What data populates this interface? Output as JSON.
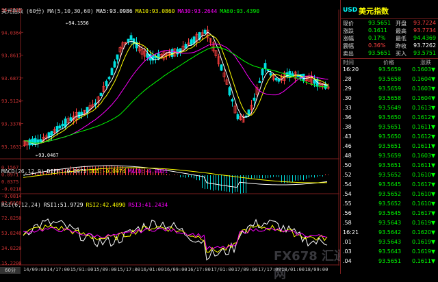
{
  "header": {
    "symbol": "美元指数",
    "period": "(60分)",
    "ma_label": "MA(5,10,30,60)",
    "ma5": "MA5:93.0986",
    "ma10": "MA10:93.0860",
    "ma30": "MA30:93.2644",
    "ma60": "MA60:93.4390"
  },
  "price_axis": [
    "94.2110",
    "94.0364",
    "93.8617",
    "93.6871",
    "93.5124",
    "93.3378",
    "93.1631"
  ],
  "annotations": {
    "high": "94.1556",
    "low": "93.0467"
  },
  "macd": {
    "label": "MACD(26,12,9)",
    "diff": "DIFF:-0.0975",
    "dea": "DEA:-0.0974",
    "macd": "MACD:-0.0001",
    "axis": [
      "0.1567",
      "0.0971",
      "0.0375",
      "-0.0218",
      "-0.0814"
    ]
  },
  "rsi": {
    "label": "RSI(6,12,24)",
    "rsi1": "RSI1:51.9729",
    "rsi2": "RSI2:42.4090",
    "rsi3": "RSI3:41.2434",
    "axis": [
      "92.8160",
      "72.8250",
      "53.8240",
      "34.8220",
      "15.2200"
    ]
  },
  "x_axis": [
    "14/09:00",
    "14/17:00",
    "15/01:00",
    "15/09:00",
    "15/17:00",
    "16/01:00",
    "16/09:00",
    "16/17:00",
    "17/01:00",
    "17/09:00",
    "17/17:00",
    "18/01:00",
    "18/09:00"
  ],
  "period_badge": "60分",
  "panel": {
    "code": "USD",
    "name": "美元指数",
    "quote_rows": [
      {
        "l1": "现价",
        "v1": "93.5651",
        "l2": "开盘",
        "v2": "93.7224"
      },
      {
        "l1": "涨跌",
        "v1": "0.1611",
        "l2": "最高",
        "v2": "93.7734"
      },
      {
        "l1": "涨幅",
        "v1": "0.17%",
        "l2": "最低",
        "v2": "94.4369"
      },
      {
        "l1": "震幅",
        "v1": "0.36%",
        "l2": "昨收",
        "v2": "93.7262"
      },
      {
        "l1": "卖出",
        "v1": "93.5651",
        "l2": "买入",
        "v2": "93.5751"
      }
    ],
    "tick_headers": {
      "time": "时间",
      "price": "价格",
      "change": "涨跌"
    },
    "ticks": [
      {
        "t": "16:20",
        "p": "93.5659",
        "c": "0.1603▼"
      },
      {
        "t": ".28",
        "p": "93.5658",
        "c": "0.1604▼"
      },
      {
        "t": ".29",
        "p": "93.5659",
        "c": "0.1603▼"
      },
      {
        "t": ".30",
        "p": "93.5658",
        "c": "0.1604▼"
      },
      {
        "t": ".33",
        "p": "93.5649",
        "c": "0.1613▼"
      },
      {
        "t": ".36",
        "p": "93.5650",
        "c": "0.1612▼"
      },
      {
        "t": ".38",
        "p": "93.5651",
        "c": "0.1611▼"
      },
      {
        "t": ".43",
        "p": "93.5650",
        "c": "0.1612▼"
      },
      {
        "t": ".46",
        "p": "93.5651",
        "c": "0.1611▼"
      },
      {
        "t": ".48",
        "p": "93.5659",
        "c": "0.1603▼"
      },
      {
        "t": ".50",
        "p": "93.5651",
        "c": "0.1611▼"
      },
      {
        "t": ".52",
        "p": "93.5652",
        "c": "0.1610▼"
      },
      {
        "t": ".54",
        "p": "93.5645",
        "c": "0.1617▼"
      },
      {
        "t": ".54",
        "p": "93.5652",
        "c": "0.1610▼"
      },
      {
        "t": ".55",
        "p": "93.5652",
        "c": "0.1610▼"
      },
      {
        "t": ".56",
        "p": "93.5645",
        "c": "0.1617▼"
      },
      {
        "t": ".58",
        "p": "93.5643",
        "c": "0.1619▼"
      },
      {
        "t": "16:21",
        "p": "93.5642",
        "c": "0.1620▼"
      },
      {
        "t": ".01",
        "p": "93.5643",
        "c": "0.1619▼"
      },
      {
        "t": ".03",
        "p": "93.5643",
        "c": "0.1619▼"
      },
      {
        "t": ".04",
        "p": "93.5651",
        "c": "0.1611▼"
      }
    ]
  },
  "watermark": "FX678 汇通网",
  "colors": {
    "up": "#ff4040",
    "down": "#00e0e0",
    "ma5": "#ffffff",
    "ma10": "#ffff00",
    "ma30": "#ff00ff",
    "ma60": "#00ff00",
    "label": "#00ffff"
  }
}
